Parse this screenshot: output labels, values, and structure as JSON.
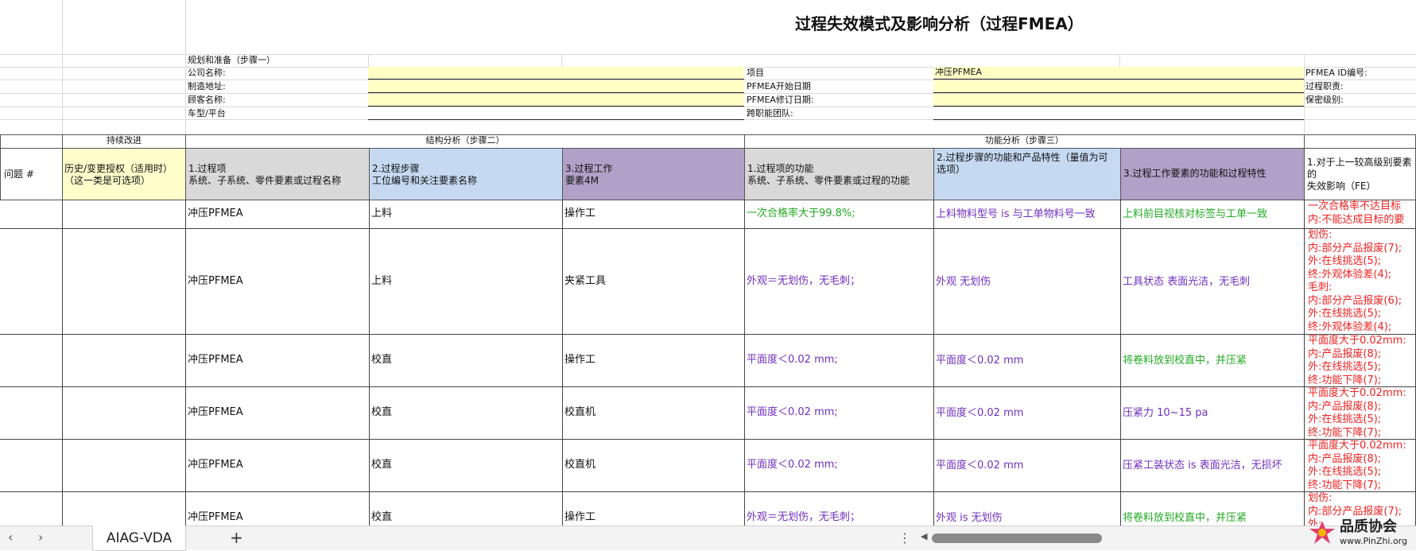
{
  "title": "过程失效模式及影响分析（过程FMEA）",
  "planning": {
    "step_label": "规划和准备（步骤一）",
    "company_label": "公司名称:",
    "address_label": "制造地址:",
    "customer_label": "顾客名称:",
    "model_label": "车型/平台",
    "project_label": "项目",
    "project_value": "冲压PFMEA",
    "start_date_label": "PFMEA开始日期",
    "revision_date_label": "PFMEA修订日期:",
    "team_label": "跨职能团队:",
    "id_label": "PFMEA ID编号:",
    "owner_label": "过程职责:",
    "confidentiality_label": "保密级别:"
  },
  "sections": {
    "continuous": "持续改进",
    "structure": "结构分析（步骤二）",
    "function": "功能分析（步骤三）"
  },
  "headers": {
    "issue": "问题 #",
    "history": "历史/变更授权（适用时）（这一类是可选项）",
    "process_item": "1.过程项\n系统、子系统、零件要素或过程名称",
    "process_step": "2.过程步骤\n工位编号和关注要素名称",
    "work_element": "3.过程工作\n要素4M",
    "item_function": "1.过程项的功能\n系统、子系统、零件要素或过程的功能",
    "step_function": "2.过程步骤的功能和产品特性（量值为可\n选项）",
    "element_function": "3.过程工作要素的功能和过程特性",
    "failure_effect": "1.对于上一较高级别要素的\n失效影响（FE）"
  },
  "rows": [
    {
      "item": "冲压PFMEA",
      "step": "上料",
      "element": "操作工",
      "item_function": "一次合格率大于99.8%;",
      "step_function": "上料物料型号 is 与工单物料号一致",
      "element_function": "上料前目视核对标签与工单一致",
      "effect": "一次合格率不达目标\n内:不能达成目标的要"
    },
    {
      "item": "冲压PFMEA",
      "step": "上料",
      "element": "夹紧工具",
      "item_function": "外观＝无划伤，无毛刺；",
      "step_function": "外观 无划伤",
      "element_function": "工具状态 表面光洁，无毛刺",
      "effect": "划伤:\n内:部分产品报废(7);\n外:在线挑选(5);\n终:外观体验差(4);\n毛刺:\n内:部分产品报废(6);\n外:在线挑选(5);\n终:外观体验差(4);"
    },
    {
      "item": "冲压PFMEA",
      "step": "校直",
      "element": "操作工",
      "item_function": "平面度＜0.02 mm;",
      "step_function": "平面度＜0.02 mm",
      "element_function": "将卷料放到校直中，并压紧",
      "effect": "平面度大于0.02mm:\n内:产品报废(8);\n外:在线挑选(5);\n终:功能下降(7);"
    },
    {
      "item": "冲压PFMEA",
      "step": "校直",
      "element": "校直机",
      "item_function": "平面度＜0.02 mm;",
      "step_function": "平面度＜0.02 mm",
      "element_function": "压紧力 10~15 pa",
      "effect": "平面度大于0.02mm:\n内:产品报废(8);\n外:在线挑选(5);\n终:功能下降(7);"
    },
    {
      "item": "冲压PFMEA",
      "step": "校直",
      "element": "校直机",
      "item_function": "平面度＜0.02 mm;",
      "step_function": "平面度＜0.02 mm",
      "element_function": "压紧工装状态 is 表面光洁，无损坏",
      "effect": "平面度大于0.02mm:\n内:产品报废(8);\n外:在线挑选(5);\n终:功能下降(7);"
    },
    {
      "item": "冲压PFMEA",
      "step": "校直",
      "element": "操作工",
      "item_function": "外观＝无划伤，无毛刺；",
      "step_function": "外观 is 无划伤",
      "element_function": "将卷料放到校直中，并压紧",
      "effect": "划伤:\n内:部分产品报废(7);\n外:"
    }
  ],
  "tabs": {
    "sheet_name": "AIAG-VDA",
    "add_label": "+"
  },
  "watermark": {
    "name": "品质协会",
    "url": "www.PinZhi.org"
  },
  "colors": {
    "yellow": "#ffffc6",
    "gray": "#d9d9d9",
    "blue": "#c5d9f1",
    "purple": "#b1a0c7",
    "green": "#22aa22",
    "violet": "#7030c0",
    "red": "#ee2222"
  }
}
